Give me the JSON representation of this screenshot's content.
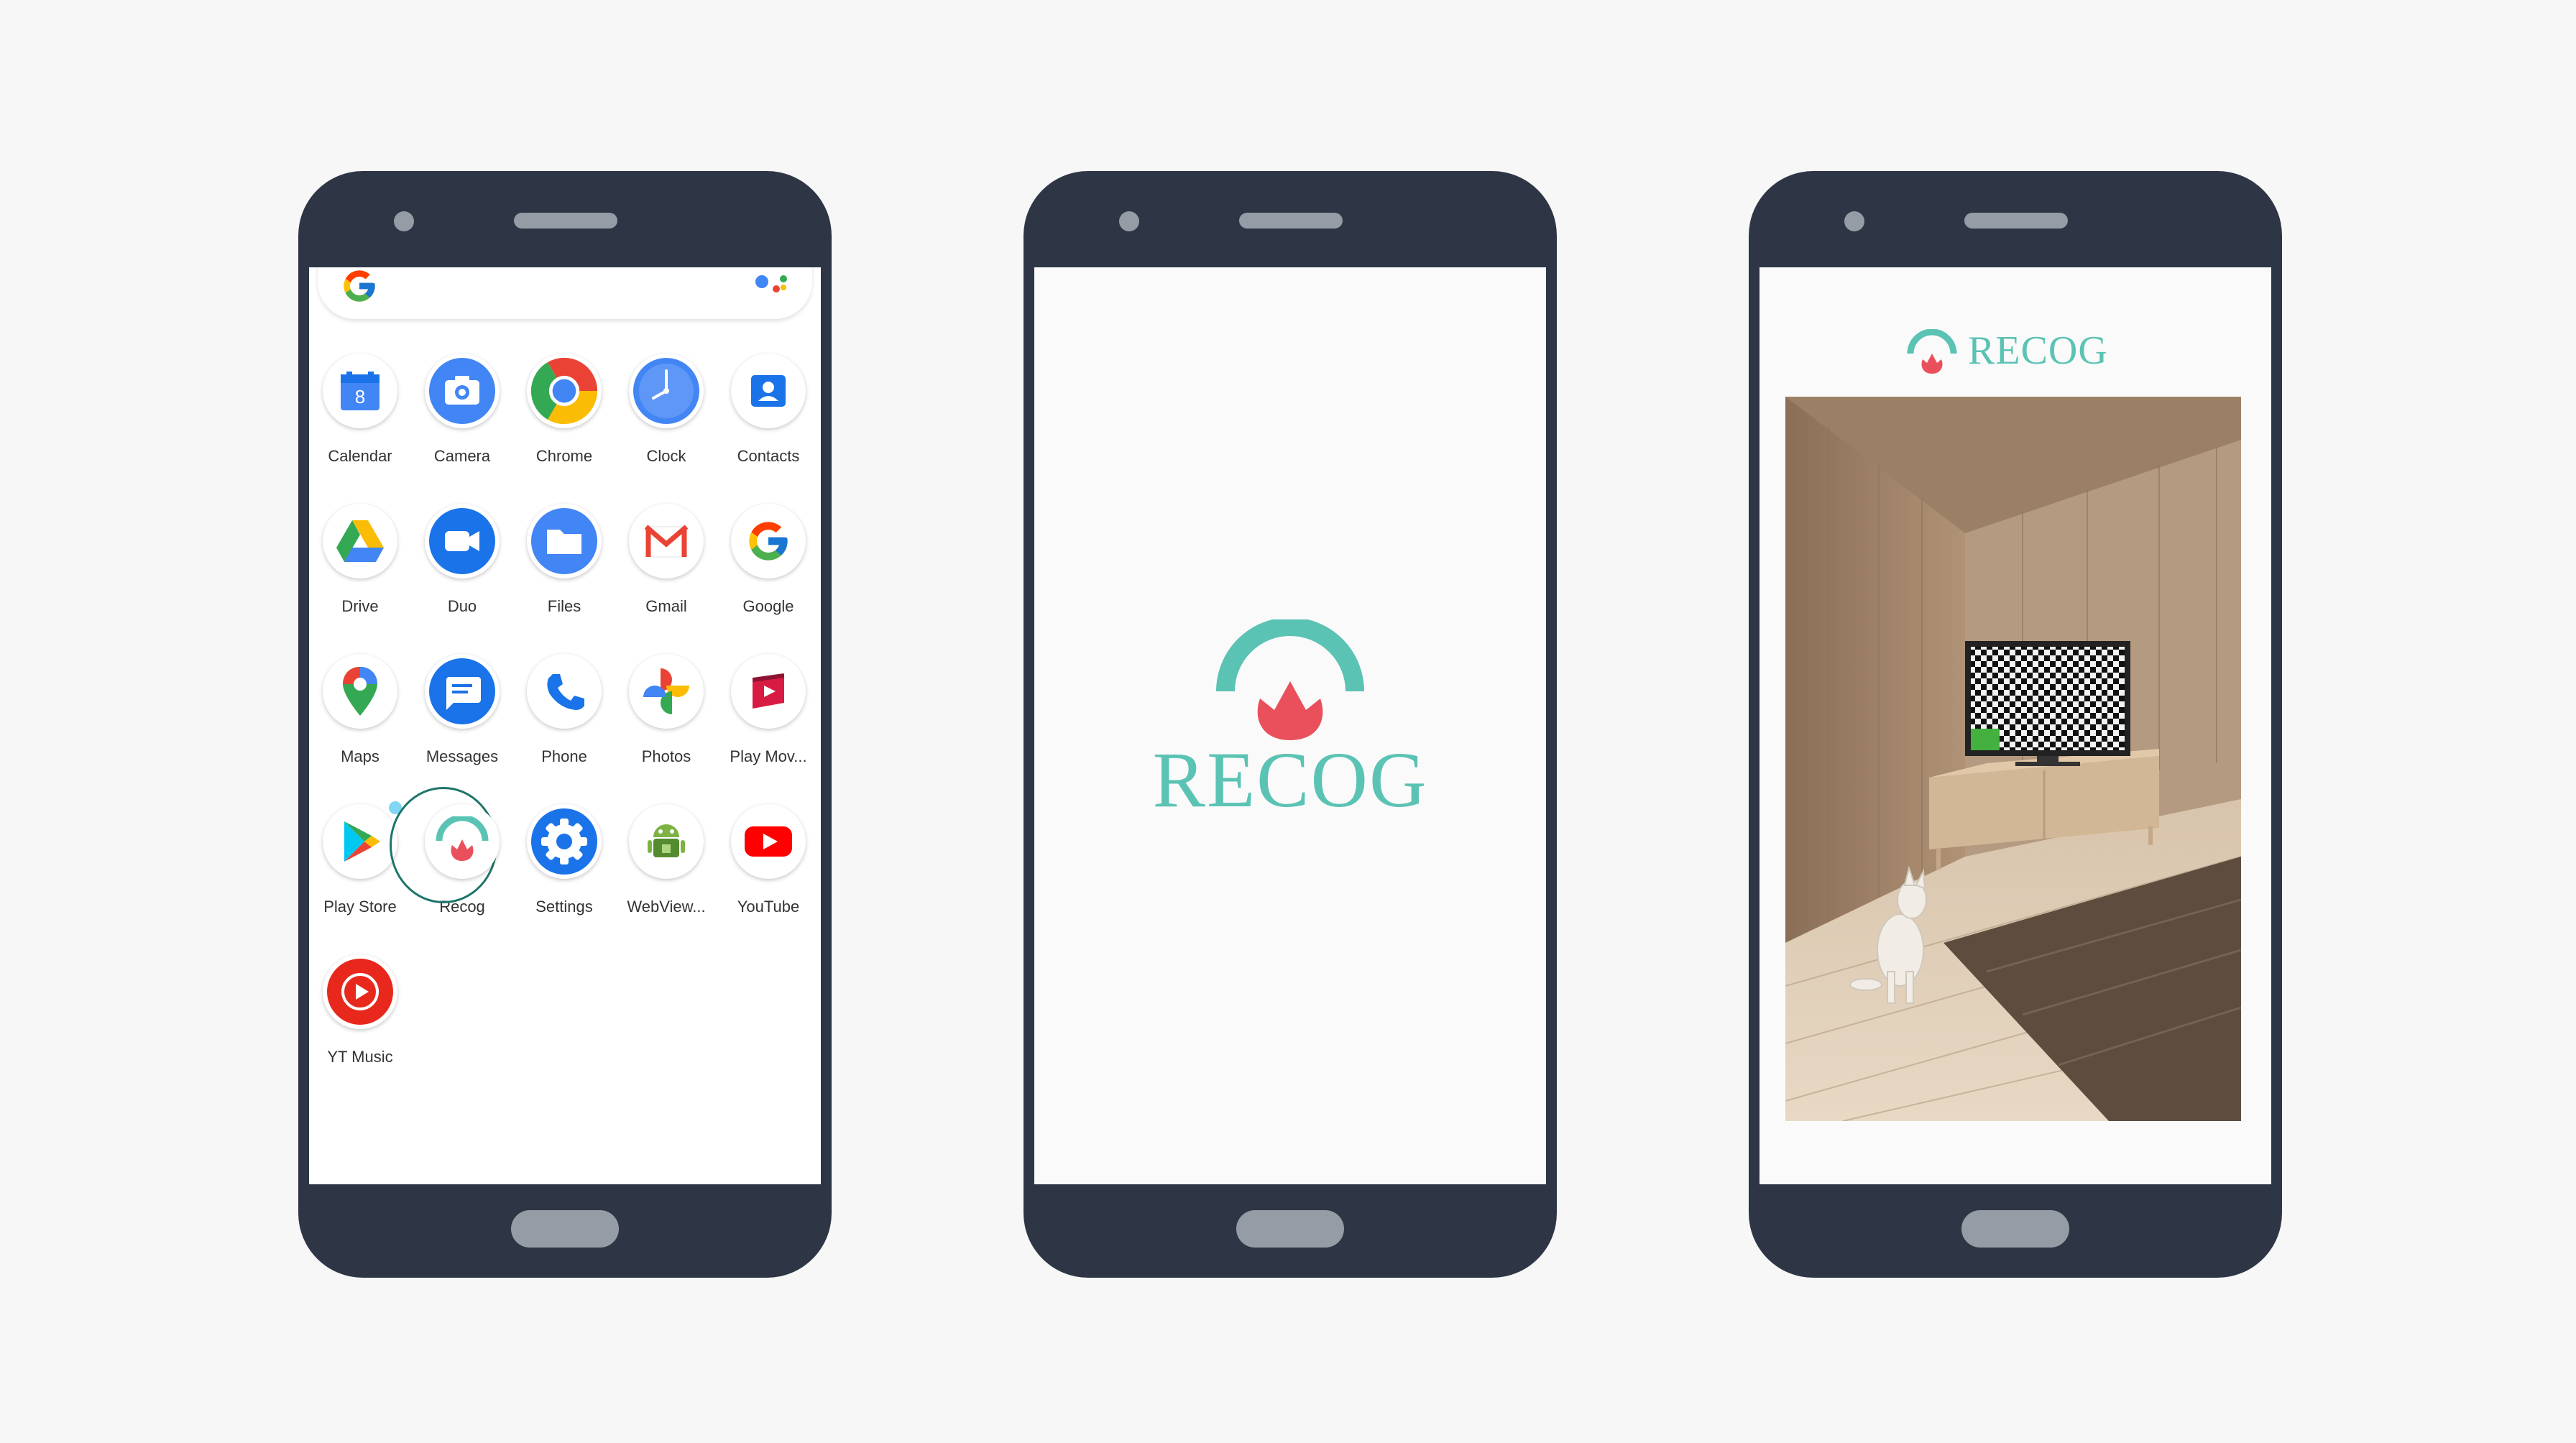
{
  "phones": {
    "launcher": {
      "apps": [
        {
          "label": "Calendar",
          "icon": "calendar-icon",
          "calendar_date": "8"
        },
        {
          "label": "Camera",
          "icon": "camera-icon"
        },
        {
          "label": "Chrome",
          "icon": "chrome-icon"
        },
        {
          "label": "Clock",
          "icon": "clock-icon"
        },
        {
          "label": "Contacts",
          "icon": "contacts-icon"
        },
        {
          "label": "Drive",
          "icon": "drive-icon"
        },
        {
          "label": "Duo",
          "icon": "duo-icon"
        },
        {
          "label": "Files",
          "icon": "files-icon"
        },
        {
          "label": "Gmail",
          "icon": "gmail-icon"
        },
        {
          "label": "Google",
          "icon": "google-icon"
        },
        {
          "label": "Maps",
          "icon": "maps-icon"
        },
        {
          "label": "Messages",
          "icon": "messages-icon"
        },
        {
          "label": "Phone",
          "icon": "phone-icon"
        },
        {
          "label": "Photos",
          "icon": "photos-icon"
        },
        {
          "label": "Play Mov...",
          "icon": "play-movies-icon"
        },
        {
          "label": "Play Store",
          "icon": "play-store-icon"
        },
        {
          "label": "Recog",
          "icon": "recog-icon",
          "highlighted": true
        },
        {
          "label": "Settings",
          "icon": "settings-icon"
        },
        {
          "label": "WebView...",
          "icon": "webview-icon"
        },
        {
          "label": "YouTube",
          "icon": "youtube-icon"
        },
        {
          "label": "YT Music",
          "icon": "yt-music-icon"
        }
      ]
    },
    "splash": {
      "brand": "RECOG"
    },
    "result": {
      "brand": "RECOG"
    }
  },
  "colors": {
    "phone_body": "#2e3545",
    "phone_details": "#969ca6",
    "brand_teal": "#5bc3b4",
    "brand_red": "#e9505c",
    "highlight_ring": "#1e7569"
  }
}
